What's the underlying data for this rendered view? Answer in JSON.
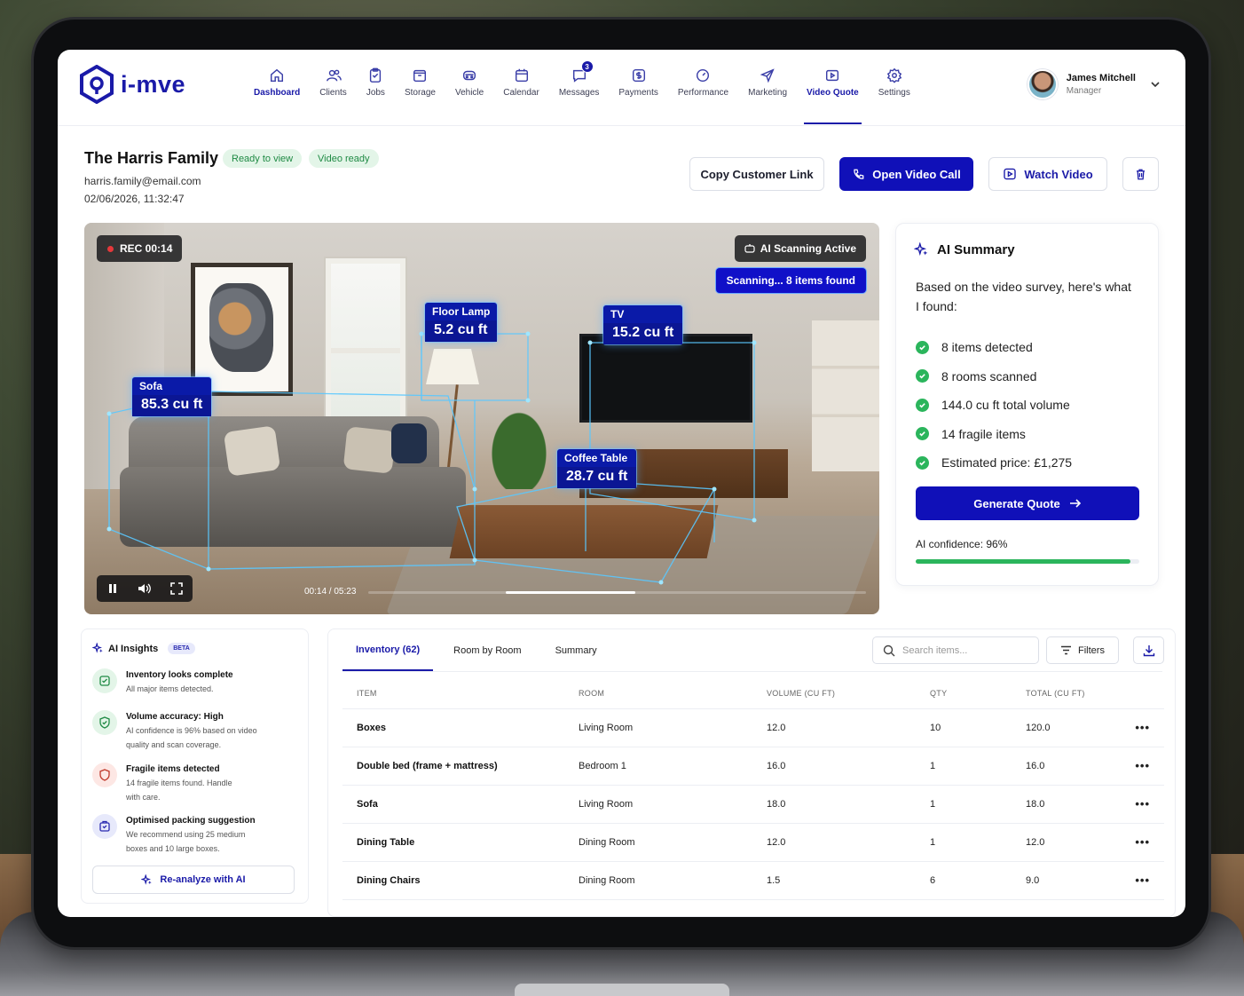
{
  "app": {
    "name": "i-mve"
  },
  "nav": [
    {
      "label": "Dashboard",
      "icon": "home-icon"
    },
    {
      "label": "Clients",
      "icon": "users-icon"
    },
    {
      "label": "Jobs",
      "icon": "clipboard-icon"
    },
    {
      "label": "Storage",
      "icon": "box-icon"
    },
    {
      "label": "Vehicle",
      "icon": "vehicle-icon"
    },
    {
      "label": "Calendar",
      "icon": "calendar-icon"
    },
    {
      "label": "Messages",
      "icon": "message-icon",
      "badge": "3"
    },
    {
      "label": "Payments",
      "icon": "payment-icon"
    },
    {
      "label": "Performance",
      "icon": "gauge-icon"
    },
    {
      "label": "Marketing",
      "icon": "send-icon"
    },
    {
      "label": "Video Quote",
      "icon": "video-icon"
    },
    {
      "label": "Settings",
      "icon": "gear-icon"
    }
  ],
  "user": {
    "name": "James Mitchell",
    "role": "Manager"
  },
  "client": {
    "name": "The Harris Family",
    "status_pill_1": "Ready to view",
    "status_pill_2": "Video ready",
    "email": "harris.family@email.com",
    "datetime": "02/06/2026, 11:32:47"
  },
  "actions": {
    "copy_link": "Copy Customer Link",
    "open_call": "Open Video Call",
    "watch_video": "Watch Video"
  },
  "video": {
    "rec": "REC 00:14",
    "scanning_active": "AI Scanning Active",
    "scan_count": "Scanning... 8 items found",
    "time": "00:14 / 05:23",
    "progress": 0.26,
    "detections": [
      {
        "name": "Sofa",
        "volume": "85.3 cu ft"
      },
      {
        "name": "Floor Lamp",
        "volume": "5.2 cu ft"
      },
      {
        "name": "TV",
        "volume": "15.2 cu ft"
      },
      {
        "name": "Coffee Table",
        "volume": "28.7 cu ft"
      }
    ]
  },
  "summary": {
    "title": "AI Summary",
    "intro": "Based on the video survey, here's what I found:",
    "points": [
      "8 items detected",
      "8 rooms scanned",
      "144.0 cu ft total volume",
      "14 fragile items",
      "Estimated price: £1,275"
    ],
    "generate": "Generate Quote",
    "confidence_label": "AI confidence: 96%",
    "confidence": 0.96,
    "accent": "#1010b8",
    "success": "#2bb55c"
  },
  "insights": {
    "title": "AI Insights",
    "beta": "BETA",
    "items": [
      {
        "title": "Inventory looks complete",
        "text": "All major items detected.",
        "icon": "box-check-icon"
      },
      {
        "title": "Volume accuracy: High",
        "text": "AI confidence is 96% based on video quality and scan coverage.",
        "icon": "shield-check-icon"
      },
      {
        "title": "Fragile items detected",
        "text": "14 fragile items found. Handle with care.",
        "icon": "fragile-shield-icon"
      },
      {
        "title": "Optimised packing suggestion",
        "text": "We recommend using 25 medium boxes and 10 large boxes.",
        "icon": "package-icon"
      }
    ],
    "reanalyze": "Re-analyze with AI"
  },
  "inventory": {
    "tabs": [
      "Inventory (62)",
      "Room by Room",
      "Summary"
    ],
    "search_placeholder": "Search items...",
    "filters": "Filters",
    "columns": [
      "ITEM",
      "ROOM",
      "VOLUME (CU FT)",
      "QTY",
      "TOTAL (CU FT)"
    ],
    "rows": [
      {
        "item": "Boxes",
        "room": "Living Room",
        "volume": "12.0",
        "qty": "10",
        "total": "120.0"
      },
      {
        "item": "Double bed (frame + mattress)",
        "room": "Bedroom 1",
        "volume": "16.0",
        "qty": "1",
        "total": "16.0"
      },
      {
        "item": "Sofa",
        "room": "Living Room",
        "volume": "18.0",
        "qty": "1",
        "total": "18.0"
      },
      {
        "item": "Dining Table",
        "room": "Dining Room",
        "volume": "12.0",
        "qty": "1",
        "total": "12.0"
      },
      {
        "item": "Dining Chairs",
        "room": "Dining Room",
        "volume": "1.5",
        "qty": "6",
        "total": "9.0"
      }
    ],
    "more": "•••"
  }
}
